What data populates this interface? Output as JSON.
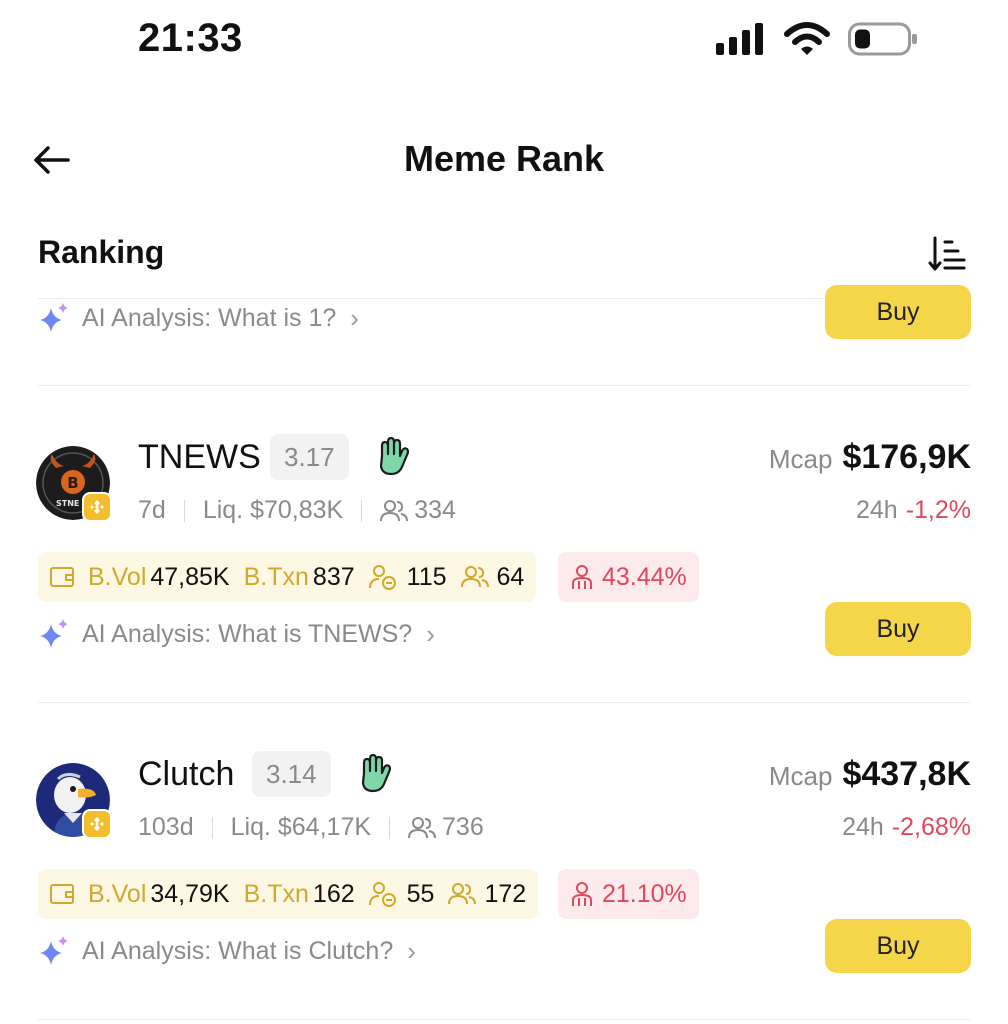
{
  "status_bar": {
    "time": "21:33"
  },
  "nav": {
    "title": "Meme Rank"
  },
  "section": {
    "title": "Ranking"
  },
  "colors": {
    "accent": "#f5d64a",
    "negative": "#e0485b",
    "gold": "#d4a72c"
  },
  "partial_item": {
    "ai_label": "AI Analysis: What is 1?",
    "buy_label": "Buy"
  },
  "tokens": [
    {
      "name": "TNEWS",
      "score": "3.17",
      "age": "7d",
      "liquidity": "Liq. $70,83K",
      "holders": "334",
      "mcap_label": "Mcap",
      "mcap_value": "$176,9K",
      "change_label": "24h",
      "change_value": "-1,2%",
      "bvol_label": "B.Vol",
      "bvol_value": "47,85K",
      "btxn_label": "B.Txn",
      "btxn_value": "837",
      "stat_a": "115",
      "stat_b": "64",
      "risk": "43.44%",
      "ai_label": "AI Analysis: What is TNEWS?",
      "buy_label": "Buy"
    },
    {
      "name": "Clutch",
      "score": "3.14",
      "age": "103d",
      "liquidity": "Liq. $64,17K",
      "holders": "736",
      "mcap_label": "Mcap",
      "mcap_value": "$437,8K",
      "change_label": "24h",
      "change_value": "-2,68%",
      "bvol_label": "B.Vol",
      "bvol_value": "34,79K",
      "btxn_label": "B.Txn",
      "btxn_value": "162",
      "stat_a": "55",
      "stat_b": "172",
      "risk": "21.10%",
      "ai_label": "AI Analysis: What is Clutch?",
      "buy_label": "Buy"
    }
  ]
}
